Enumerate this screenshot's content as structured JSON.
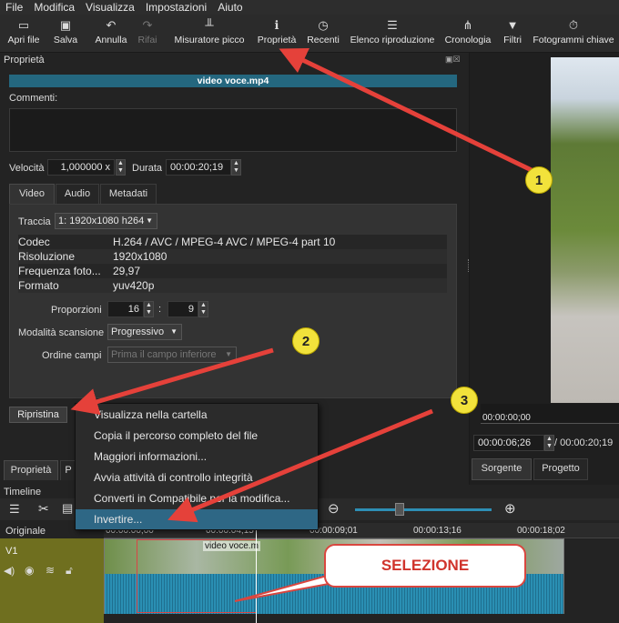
{
  "menubar": [
    "File",
    "Modifica",
    "Visualizza",
    "Impostazioni",
    "Aiuto"
  ],
  "toolbar": [
    {
      "label": "Apri file",
      "icon": "folder-icon"
    },
    {
      "label": "Salva",
      "icon": "save-icon"
    },
    {
      "label": "Annulla",
      "icon": "undo-icon"
    },
    {
      "label": "Rifai",
      "icon": "redo-icon"
    },
    {
      "label": "Misuratore picco",
      "icon": "meter-icon"
    },
    {
      "label": "Proprietà",
      "icon": "info-icon"
    },
    {
      "label": "Recenti",
      "icon": "clock-icon"
    },
    {
      "label": "Elenco riproduzione",
      "icon": "list-icon"
    },
    {
      "label": "Cronologia",
      "icon": "history-icon"
    },
    {
      "label": "Filtri",
      "icon": "filter-icon"
    },
    {
      "label": "Fotogrammi chiave",
      "icon": "stopwatch-icon"
    }
  ],
  "properties": {
    "title": "Proprietà",
    "filename": "video voce.mp4",
    "comments_label": "Commenti:",
    "speed_label": "Velocità",
    "speed_value": "1,000000 x",
    "duration_label": "Durata",
    "duration_value": "00:00:20;19",
    "tabs": [
      "Video",
      "Audio",
      "Metadati"
    ],
    "track_label": "Traccia",
    "track_value": "1: 1920x1080 h264",
    "info_rows": [
      {
        "key": "Codec",
        "value": "H.264 / AVC / MPEG-4 AVC / MPEG-4 part 10"
      },
      {
        "key": "Risoluzione",
        "value": "1920x1080"
      },
      {
        "key": "Frequenza foto...",
        "value": "29,97"
      },
      {
        "key": "Formato",
        "value": "yuv420p"
      }
    ],
    "aspect_label": "Proporzioni",
    "aspect_w": "16",
    "aspect_h": "9",
    "scan_label": "Modalità scansione",
    "scan_value": "Progressivo",
    "field_order_label": "Ordine campi",
    "field_order_value": "Prima il campo inferiore",
    "reset_button": "Ripristina"
  },
  "context_menu": [
    "Visualizza nella cartella",
    "Copia il percorso completo del file",
    "Maggiori informazioni...",
    "Avvia attività di controllo integrità",
    "Converti in Compatibile per la modifica...",
    "Invertire..."
  ],
  "bottom_tabs": {
    "properties": "Proprietà",
    "p2": "P"
  },
  "player": {
    "timecode_top": "00:00:00;00",
    "position": "00:00:06;26",
    "total": "/ 00:00:20;19",
    "source_tab": "Sorgente",
    "project_tab": "Progetto"
  },
  "timeline": {
    "title": "Timeline",
    "track_original": "Originale",
    "track_v1": "V1",
    "ruler": [
      "00:00:00;00",
      "00:00:04;15",
      "00:00:09;01",
      "00:00:13;16",
      "00:00:18;02"
    ],
    "clip_name": "video voce.m"
  },
  "annotations": {
    "badges": [
      "1",
      "2",
      "3"
    ],
    "callout": "SELEZIONE",
    "arrow_color": "#e5413a"
  }
}
